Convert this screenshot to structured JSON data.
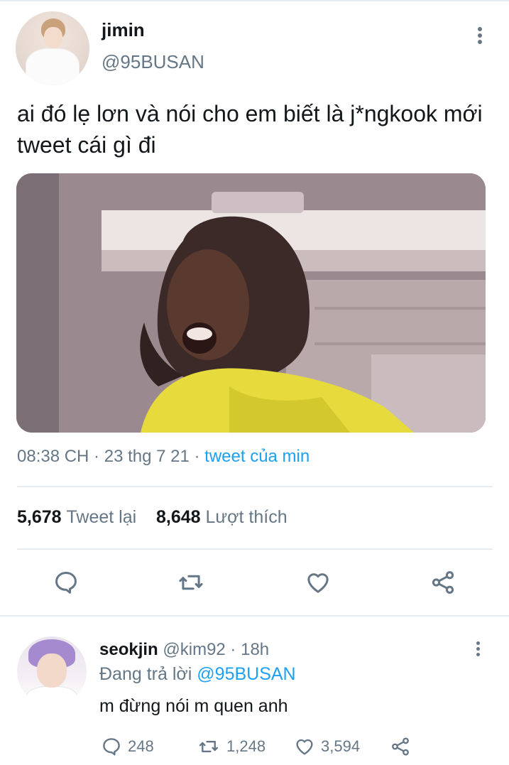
{
  "tweet": {
    "display_name": "jimin",
    "handle": "@95BUSAN",
    "text": "ai đó lẹ lơn và nói cho em biết là j*ngkook mới tweet cái gì đi",
    "time": "08:38 CH",
    "date": "23 thg 7 21",
    "separator": " · ",
    "source": "tweet của min",
    "retweet_count": "5,678",
    "retweet_label": "Tweet lại",
    "like_count": "8,648",
    "like_label": "Lượt thích",
    "icons": [
      "more-vertical-icon",
      "reply-icon",
      "retweet-icon",
      "like-icon",
      "share-icon"
    ]
  },
  "reply": {
    "display_name": "seokjin",
    "handle": "@kim92",
    "time": "18h",
    "separator": " · ",
    "replying_prefix": "Đang trả lời",
    "replying_to": "@95BUSAN",
    "text": "m đừng nói m quen anh",
    "reply_count": "248",
    "retweet_count": "1,248",
    "like_count": "3,594"
  },
  "colors": {
    "accent": "#1da1f2",
    "secondary_text": "#657786",
    "primary_text": "#14171a",
    "divider": "#e6ecf0"
  }
}
